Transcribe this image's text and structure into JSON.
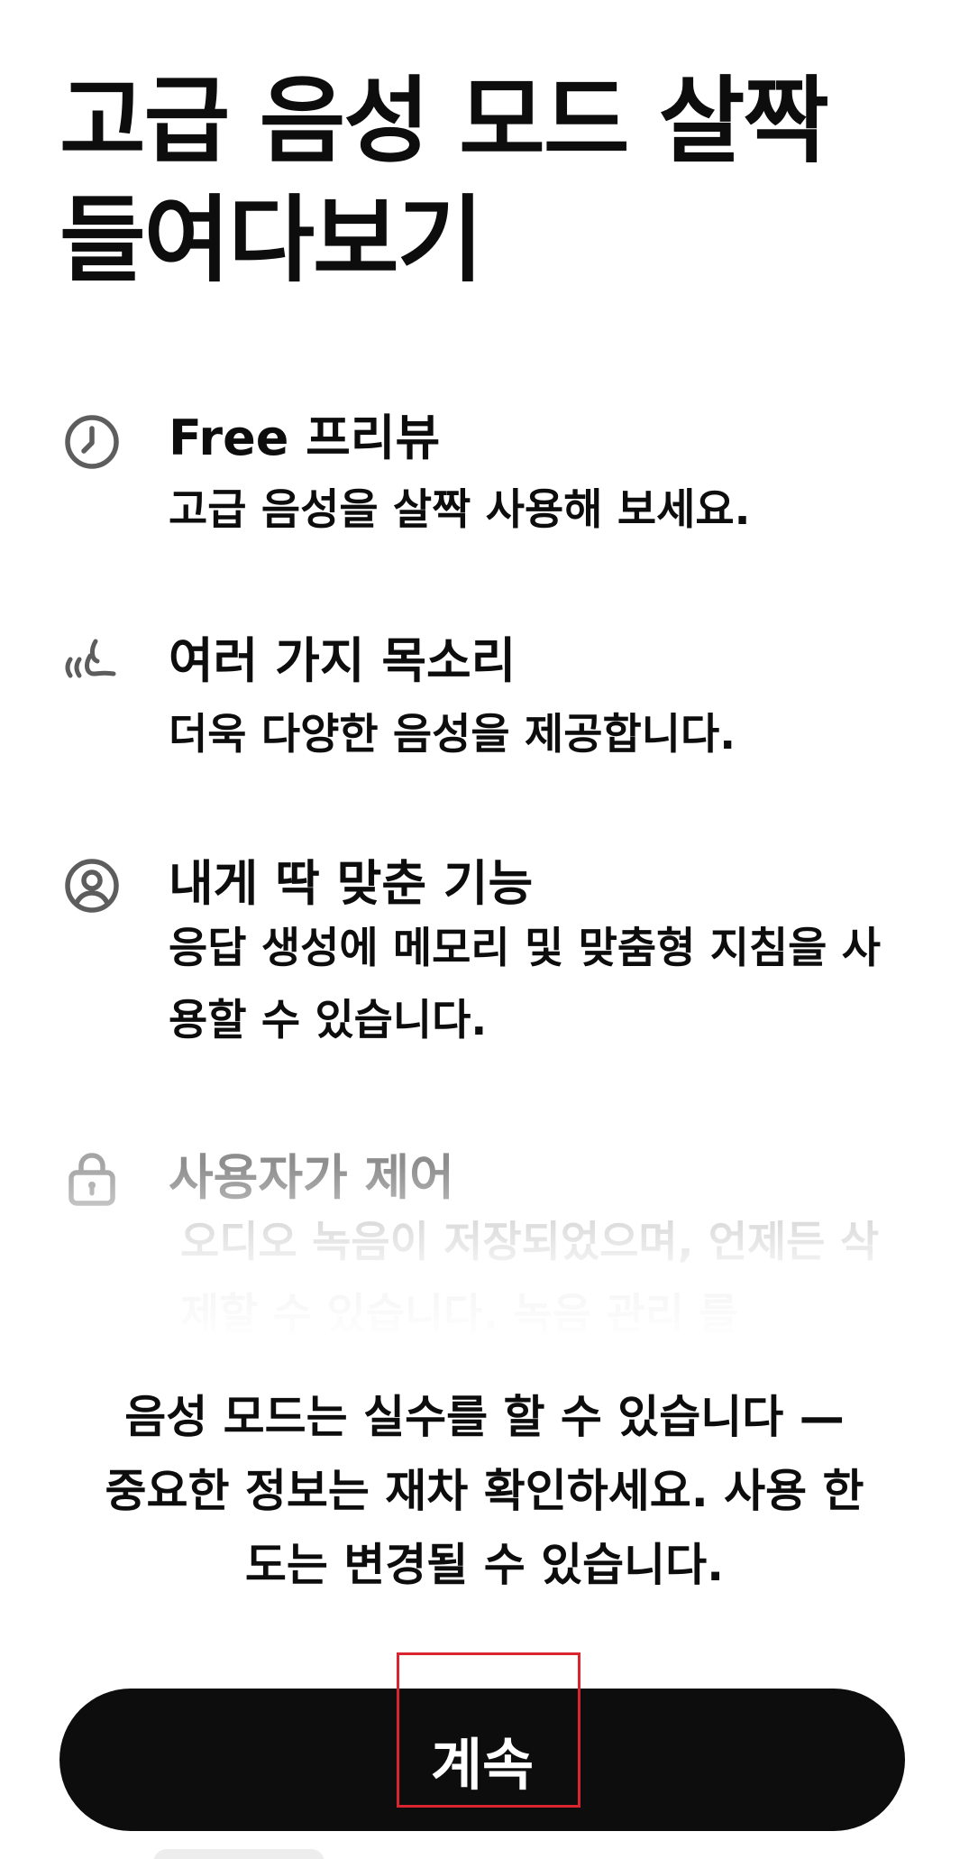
{
  "title": "고급 음성 모드 살짝 들여다보기",
  "features": [
    {
      "icon": "clock-icon",
      "title": "Free 프리뷰",
      "description": "고급 음성을 살짝 사용해 보세요."
    },
    {
      "icon": "voice-waves-icon",
      "title": "여러 가지 목소리",
      "description": "더욱 다양한 음성을 제공합니다."
    },
    {
      "icon": "user-circle-icon",
      "title": "내게 딱 맞춘 기능",
      "description": "응답 생성에 메모리 및 맞춤형 지침을 사용할 수 있습니다."
    },
    {
      "icon": "lock-icon",
      "title": "사용자가 제어",
      "description": "오디오 녹음이 저장되었으며, 언제든 삭제할 수 있습니다. 녹음 관리 를"
    }
  ],
  "disclaimer": "음성 모드는 실수를 할 수 있습니다 — 중요한 정보는 재차 확인하세요. 사용 한도는 변경될 수 있습니다.",
  "continue_button": {
    "label": "계속"
  },
  "colors": {
    "primary": "#0d0d0d",
    "muted_title": "#8e8e8e",
    "muted_text": "#bdbdbd",
    "icon": "#5d5d5d",
    "highlight": "#d9252f",
    "background": "#ffffff"
  }
}
